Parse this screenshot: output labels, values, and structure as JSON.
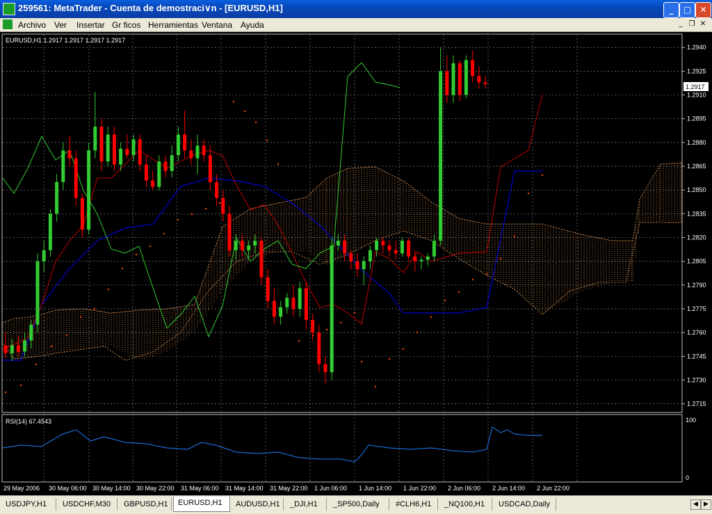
{
  "window": {
    "title": "259561: MetaTrader - Cuenta de demostraci∨n - [EURUSD,H1]",
    "minimize": "_",
    "maximize": "□",
    "close": "✕"
  },
  "menu": [
    "Archivo",
    "Ver",
    "Insertar",
    "Gr ficos",
    "Herramientas",
    "Ventana",
    "Ayuda"
  ],
  "mdi_buttons": [
    "_",
    "❐",
    "✕"
  ],
  "chart": {
    "symbol_info": "EURUSD,H1  1.2917 1.2917 1.2917 1.2917",
    "current_price": "1.2917",
    "price_labels": [
      "1.2940",
      "1.2925",
      "1.2910",
      "1.2895",
      "1.2880",
      "1.2865",
      "1.2850",
      "1.2835",
      "1.2820",
      "1.2805",
      "1.2790",
      "1.2775",
      "1.2760",
      "1.2745",
      "1.2730",
      "1.2715"
    ],
    "time_labels": [
      "29 May 2006",
      "30 May 06:00",
      "30 May 14:00",
      "30 May 22:00",
      "31 May 06:00",
      "31 May 14:00",
      "31 May 22:00",
      "1 Jun 06:00",
      "1 Jun 14:00",
      "1 Jun 22:00",
      "2 Jun 06:00",
      "2 Jun 14:00",
      "2 Jun 22:00"
    ],
    "colors": {
      "bull": "#32cd32",
      "bear": "#ff0000",
      "kijun": "#0000ff",
      "tenkan": "#c00000",
      "chikou": "#32cd32",
      "cloud": "#f4a460",
      "sar": "#ff4500",
      "grid": "#7f7f7f",
      "rsi": "#1e7fff"
    }
  },
  "rsi": {
    "label": "RSI(14) 67.4543",
    "levels": [
      "100",
      "0"
    ]
  },
  "tabs": [
    "USDJPY,H1",
    "USDCHF,M30",
    "GBPUSD,H1",
    "EURUSD,H1",
    "AUDUSD,H1",
    "_DJI,H1",
    "_SP500,Daily",
    "#CLH6,H1",
    "_NQ100,H1",
    "USDCAD,Daily"
  ],
  "active_tab": "EURUSD,H1",
  "chart_data": {
    "type": "candlestick",
    "series": [
      {
        "values": [
          [
            1.2752,
            1.276,
            1.2744,
            1.2747
          ],
          [
            1.2747,
            1.2756,
            1.2742,
            1.2752
          ],
          [
            1.2752,
            1.2758,
            1.2745,
            1.2748
          ],
          [
            1.2748,
            1.276,
            1.2745,
            1.2755
          ],
          [
            1.2755,
            1.2768,
            1.275,
            1.2765
          ],
          [
            1.2765,
            1.281,
            1.276,
            1.2805
          ],
          [
            1.2805,
            1.2818,
            1.2798,
            1.2812
          ],
          [
            1.2812,
            1.2838,
            1.2808,
            1.2835
          ],
          [
            1.2835,
            1.286,
            1.283,
            1.2855
          ],
          [
            1.2855,
            1.288,
            1.285,
            1.2875
          ],
          [
            1.2875,
            1.2884,
            1.2865,
            1.287
          ],
          [
            1.287,
            1.2875,
            1.284,
            1.2845
          ],
          [
            1.2845,
            1.2848,
            1.282,
            1.2825
          ],
          [
            1.2825,
            1.288,
            1.2822,
            1.2875
          ],
          [
            1.2875,
            1.2912,
            1.287,
            1.289
          ],
          [
            1.289,
            1.2895,
            1.2862,
            1.2868
          ],
          [
            1.2868,
            1.289,
            1.2865,
            1.2885
          ],
          [
            1.2885,
            1.289,
            1.2862,
            1.2866
          ],
          [
            1.2866,
            1.288,
            1.2862,
            1.2876
          ],
          [
            1.2876,
            1.2885,
            1.287,
            1.2872
          ],
          [
            1.2872,
            1.2885,
            1.2868,
            1.2882
          ],
          [
            1.2882,
            1.2885,
            1.2862,
            1.2866
          ],
          [
            1.2866,
            1.2872,
            1.2852,
            1.2856
          ],
          [
            1.2856,
            1.2862,
            1.285,
            1.2852
          ],
          [
            1.2852,
            1.2872,
            1.285,
            1.2868
          ],
          [
            1.2868,
            1.2872,
            1.2858,
            1.2862
          ],
          [
            1.2862,
            1.2878,
            1.2858,
            1.2872
          ],
          [
            1.2872,
            1.289,
            1.2868,
            1.2885
          ],
          [
            1.2885,
            1.29,
            1.287,
            1.2875
          ],
          [
            1.2875,
            1.2882,
            1.2866,
            1.287
          ],
          [
            1.287,
            1.2885,
            1.286,
            1.2878
          ],
          [
            1.2878,
            1.2882,
            1.2868,
            1.2872
          ],
          [
            1.2872,
            1.2878,
            1.285,
            1.2855
          ],
          [
            1.2855,
            1.286,
            1.284,
            1.2845
          ],
          [
            1.2845,
            1.285,
            1.283,
            1.2835
          ],
          [
            1.2835,
            1.284,
            1.2808,
            1.2812
          ],
          [
            1.2812,
            1.2822,
            1.2806,
            1.2818
          ],
          [
            1.2818,
            1.2822,
            1.2808,
            1.2812
          ],
          [
            1.2812,
            1.2818,
            1.2806,
            1.2815
          ],
          [
            1.2815,
            1.2822,
            1.281,
            1.2818
          ],
          [
            1.2818,
            1.282,
            1.279,
            1.2795
          ],
          [
            1.2795,
            1.28,
            1.2775,
            1.278
          ],
          [
            1.278,
            1.2788,
            1.2765,
            1.277
          ],
          [
            1.277,
            1.278,
            1.2765,
            1.2776
          ],
          [
            1.2776,
            1.2785,
            1.2772,
            1.2782
          ],
          [
            1.2782,
            1.279,
            1.277,
            1.2775
          ],
          [
            1.2775,
            1.2792,
            1.277,
            1.2788
          ],
          [
            1.2788,
            1.2792,
            1.2762,
            1.2768
          ],
          [
            1.2768,
            1.2772,
            1.2755,
            1.276
          ],
          [
            1.276,
            1.2765,
            1.2735,
            1.274
          ],
          [
            1.274,
            1.2745,
            1.2728,
            1.2735
          ],
          [
            1.2735,
            1.282,
            1.273,
            1.2815
          ],
          [
            1.2815,
            1.2822,
            1.2812,
            1.2818
          ],
          [
            1.2818,
            1.2822,
            1.2805,
            1.281
          ],
          [
            1.281,
            1.2812,
            1.28,
            1.2805
          ],
          [
            1.2805,
            1.281,
            1.2795,
            1.28
          ],
          [
            1.28,
            1.2808,
            1.279,
            1.2805
          ],
          [
            1.2805,
            1.2815,
            1.28,
            1.2812
          ],
          [
            1.2812,
            1.282,
            1.2808,
            1.2818
          ],
          [
            1.2818,
            1.282,
            1.281,
            1.2815
          ],
          [
            1.2815,
            1.2818,
            1.2808,
            1.2812
          ],
          [
            1.2812,
            1.2818,
            1.2806,
            1.281
          ],
          [
            1.281,
            1.282,
            1.2808,
            1.2818
          ],
          [
            1.2818,
            1.282,
            1.2805,
            1.2808
          ],
          [
            1.2808,
            1.2812,
            1.2798,
            1.2805
          ],
          [
            1.2805,
            1.2808,
            1.28,
            1.2806
          ],
          [
            1.2806,
            1.281,
            1.2802,
            1.2808
          ],
          [
            1.2808,
            1.2822,
            1.2805,
            1.2818
          ],
          [
            1.2818,
            1.294,
            1.2815,
            1.2925
          ],
          [
            1.2925,
            1.2935,
            1.2905,
            1.291
          ],
          [
            1.291,
            1.2935,
            1.2905,
            1.293
          ],
          [
            1.293,
            1.2932,
            1.2906,
            1.291
          ],
          [
            1.291,
            1.2935,
            1.2908,
            1.2932
          ],
          [
            1.2932,
            1.2938,
            1.2918,
            1.2922
          ],
          [
            1.2922,
            1.2928,
            1.2914,
            1.2918
          ],
          [
            1.2918,
            1.2922,
            1.2914,
            1.2917
          ]
        ]
      }
    ],
    "ylim": [
      1.271,
      1.2948
    ]
  }
}
